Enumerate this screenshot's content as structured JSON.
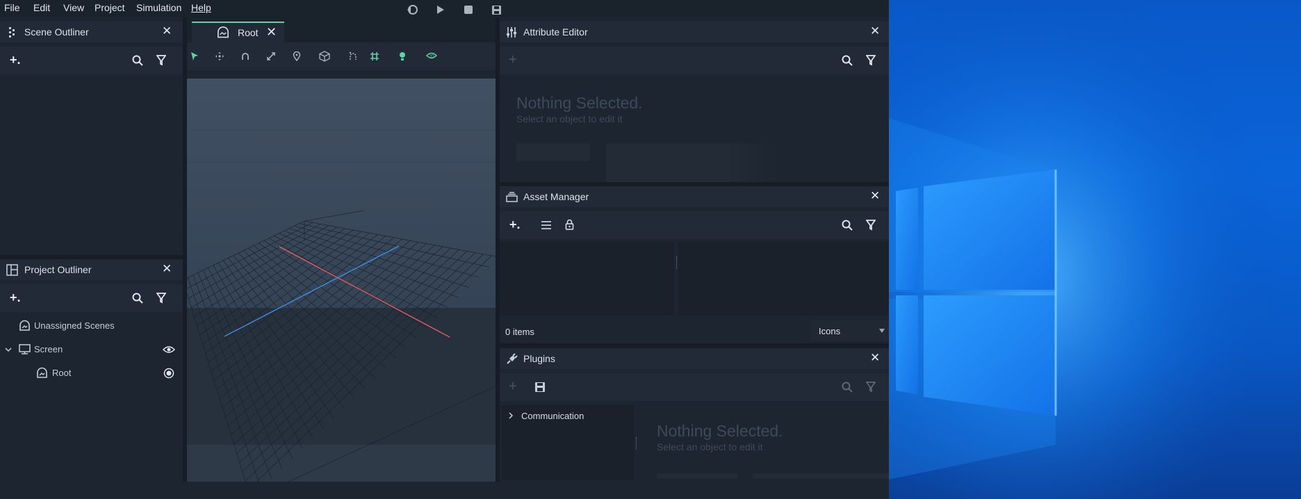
{
  "menubar": {
    "items": [
      "File",
      "Edit",
      "View",
      "Project",
      "Simulation",
      "Help"
    ]
  },
  "scene_outliner": {
    "title": "Scene Outliner",
    "add_label": "+."
  },
  "project_outliner": {
    "title": "Project Outliner",
    "add_label": "+.",
    "items": [
      {
        "label": "Unassigned Scenes"
      },
      {
        "label": "Screen"
      },
      {
        "label": "Root"
      }
    ]
  },
  "viewport": {
    "tab_label": "Root"
  },
  "attribute_editor": {
    "title": "Attribute Editor",
    "empty_title": "Nothing Selected.",
    "empty_subtitle": "Select an object to edit it"
  },
  "asset_manager": {
    "title": "Asset Manager",
    "add_label": "+.",
    "item_count": "0 items",
    "view_mode": "Icons"
  },
  "plugins": {
    "title": "Plugins",
    "tree_item": "Communication",
    "empty_title": "Nothing Selected.",
    "empty_subtitle": "Select an object to edit it"
  },
  "colors": {
    "accent": "#5fd0a8",
    "x_axis": "#e05a64",
    "z_axis": "#3a8fe0",
    "panel_bg": "#1d2530"
  }
}
